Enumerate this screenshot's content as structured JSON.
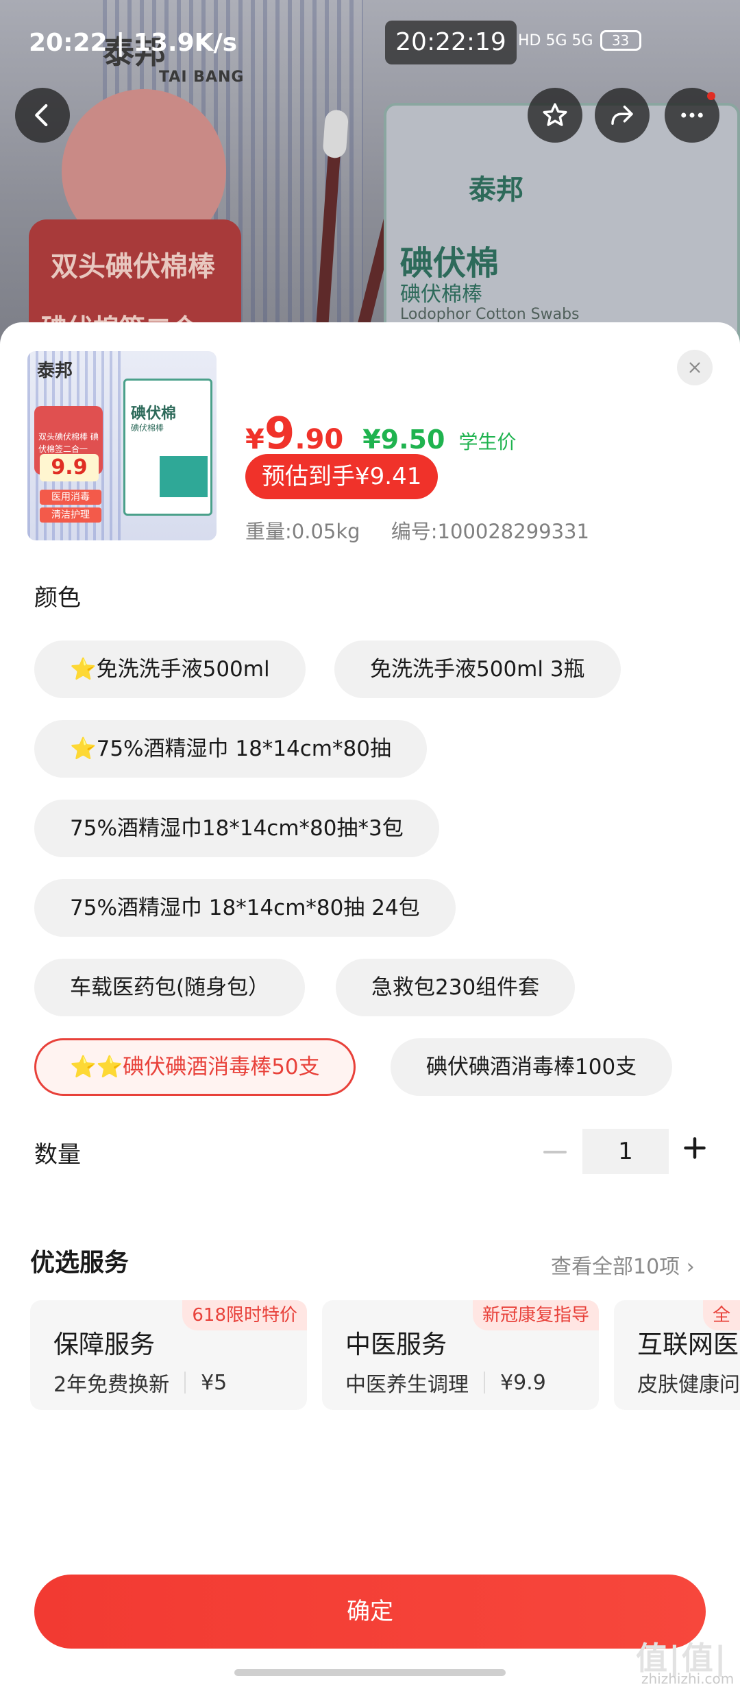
{
  "status_bar": {
    "left_text": "20:22 | 13.9K/s",
    "clock": "20:22:19",
    "network": "HD 5G 5G",
    "battery": "33"
  },
  "background": {
    "brand": "泰邦",
    "brand_en": "TAI BANG",
    "banner_line1": "双头碘伏棉棒",
    "banner_line2": "碘伏棉签二合一",
    "box_name": "碘伏棉",
    "box_sub": "碘伏棉棒",
    "box_en": "Lodophor Cotton Swabs"
  },
  "product": {
    "thumb_brand": "泰邦",
    "thumb_box_name": "碘伏棉",
    "thumb_box_sub": "碘伏棉棒",
    "thumb_banner": "双头碘伏棉棒 碘伏棉签二合一",
    "thumb_price": "9.9",
    "thumb_tag1": "医用消毒",
    "thumb_tag2": "清洁护理",
    "price_currency": "¥",
    "price_int": "9",
    "price_dec": ".90",
    "price_student": "¥9.50",
    "price_student_label": "学生价",
    "estimate": "预估到手¥9.41",
    "weight": "重量:0.05kg",
    "sku": "编号:100028299331"
  },
  "color_section": {
    "title": "颜色",
    "options": [
      {
        "label": "免洗洗手液500ml",
        "stars": "⭐",
        "selected": false
      },
      {
        "label": "免洗洗手液500ml 3瓶",
        "stars": "",
        "selected": false
      },
      {
        "label": "75%酒精湿巾 18*14cm*80抽",
        "stars": "⭐",
        "selected": false
      },
      {
        "label": "75%酒精湿巾18*14cm*80抽*3包",
        "stars": "",
        "selected": false
      },
      {
        "label": "75%酒精湿巾 18*14cm*80抽 24包",
        "stars": "",
        "selected": false
      },
      {
        "label": "车载医药包(随身包）",
        "stars": "",
        "selected": false
      },
      {
        "label": "急救包230组件套",
        "stars": "",
        "selected": false
      },
      {
        "label": "碘伏碘酒消毒棒50支",
        "stars": "⭐⭐",
        "selected": true
      },
      {
        "label": "碘伏碘酒消毒棒100支",
        "stars": "",
        "selected": false
      }
    ]
  },
  "quantity": {
    "title": "数量",
    "value": "1"
  },
  "services": {
    "title": "优选服务",
    "view_all": "查看全部10项 ›",
    "cards": [
      {
        "badge": "618限时特价",
        "name": "保障服务",
        "desc": "2年免费换新",
        "price": "¥5"
      },
      {
        "badge": "新冠康复指导",
        "name": "中医服务",
        "desc": "中医养生调理",
        "price": "¥9.9"
      },
      {
        "badge": "全",
        "name": "互联网医",
        "desc": "皮肤健康问",
        "price": ""
      }
    ]
  },
  "confirm_label": "确定",
  "watermark": {
    "main": "值|值|值",
    "sub": "zhizhizhi.com"
  },
  "colors": {
    "accent": "#f0322a",
    "student_green": "#1fb34f",
    "star": "#f5b800"
  }
}
